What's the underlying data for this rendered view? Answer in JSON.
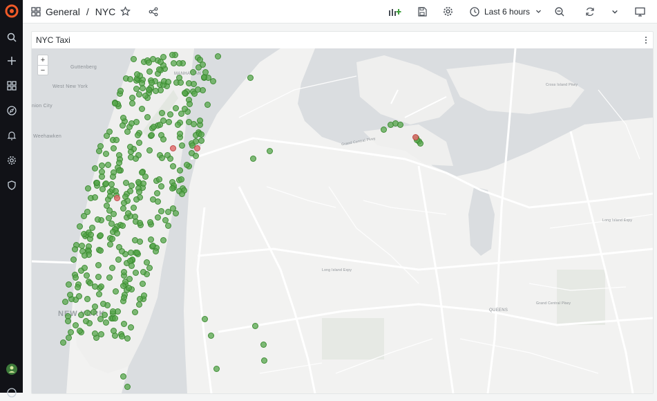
{
  "breadcrumb": {
    "folder": "General",
    "separator": "/",
    "dashboard": "NYC"
  },
  "time_picker": {
    "label": "Last 6 hours"
  },
  "panel": {
    "title": "NYC Taxi"
  },
  "map": {
    "zoom_in": "+",
    "zoom_out": "−",
    "labels": {
      "guttenberg": "Guttenberg",
      "west_new_york": "West New York",
      "union_city": "nion City",
      "weehawken": "Weehawken",
      "manhattan": "MANHATTAN",
      "new_york": "NEW YORK",
      "queens": "QUEENS",
      "grand_central_pkwy": "Grand Central Pkwy",
      "cross_island_pkwy": "Cross Island Pkwy",
      "long_island_expy": "Long Island Expy",
      "long_island_expy2": "Long Island Expy",
      "grand_central_pkwy2": "Grand Central Pkwy"
    },
    "colors": {
      "normal_point": "#56a64b",
      "alert_point": "#e06e6e"
    }
  }
}
